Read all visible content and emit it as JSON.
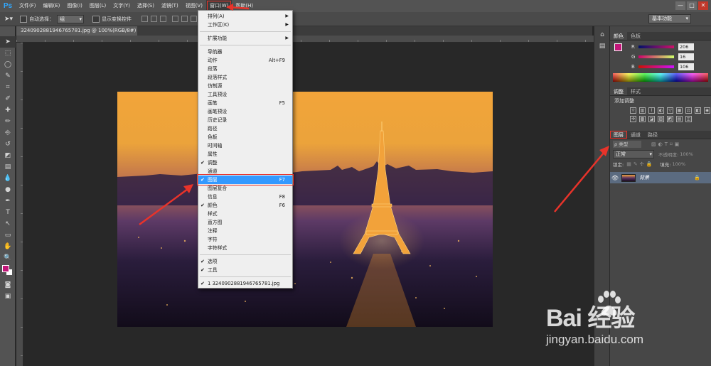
{
  "app": {
    "logo": "Ps"
  },
  "menubar": {
    "items": [
      "文件(F)",
      "编辑(E)",
      "图像(I)",
      "图层(L)",
      "文字(Y)",
      "选择(S)",
      "滤镜(T)",
      "视图(V)",
      "窗口(W)",
      "帮助(H)"
    ],
    "active_index": 8
  },
  "window_controls": {
    "minimize": "—",
    "maximize": "□",
    "close": "✕"
  },
  "options_bar": {
    "auto_select_label": "自动选择：",
    "auto_select_value": "组",
    "show_transform_label": "显示变换控件",
    "workspace": "基本功能"
  },
  "document": {
    "tab_title": "3240902881946765781.jpg @ 100%(RGB/8#)"
  },
  "toolbar": {
    "tools": [
      "move-icon",
      "marquee-icon",
      "lasso-icon",
      "quick-select-icon",
      "crop-icon",
      "eyedropper-icon",
      "healing-icon",
      "brush-icon",
      "clone-stamp-icon",
      "history-brush-icon",
      "eraser-icon",
      "gradient-icon",
      "blur-icon",
      "dodge-icon",
      "pen-icon",
      "type-icon",
      "path-select-icon",
      "rectangle-icon",
      "hand-icon",
      "zoom-icon"
    ],
    "glyphs": [
      "➤",
      "⬚",
      "◯",
      "✎",
      "⌗",
      "✐",
      "✚",
      "✏",
      "⎆",
      "↺",
      "◩",
      "▤",
      "💧",
      "●",
      "✒",
      "T",
      "↖",
      "▭",
      "✋",
      "🔍"
    ],
    "foreground_color": "#c2177a",
    "background_color": "#ffffff"
  },
  "window_menu": {
    "items": [
      {
        "label": "排列(A)",
        "submenu": true
      },
      {
        "label": "工作区(K)",
        "submenu": true
      },
      {
        "sep": true
      },
      {
        "label": "扩展功能",
        "submenu": true
      },
      {
        "sep": true
      },
      {
        "label": "导航器"
      },
      {
        "label": "动作",
        "shortcut": "Alt+F9"
      },
      {
        "label": "段落"
      },
      {
        "label": "段落样式"
      },
      {
        "label": "仿制源"
      },
      {
        "label": "工具预设"
      },
      {
        "label": "画笔",
        "shortcut": "F5"
      },
      {
        "label": "画笔预设"
      },
      {
        "label": "历史记录"
      },
      {
        "label": "路径"
      },
      {
        "label": "色板"
      },
      {
        "label": "时间轴"
      },
      {
        "label": "属性"
      },
      {
        "label": "调整",
        "checked": true
      },
      {
        "label": "通道"
      },
      {
        "label": "图层",
        "shortcut": "F7",
        "checked": true,
        "highlighted": true
      },
      {
        "label": "图层复合"
      },
      {
        "label": "信息",
        "shortcut": "F8"
      },
      {
        "label": "颜色",
        "shortcut": "F6",
        "checked": true
      },
      {
        "label": "样式"
      },
      {
        "label": "直方图"
      },
      {
        "label": "注释"
      },
      {
        "label": "字符"
      },
      {
        "label": "字符样式"
      },
      {
        "sep": true
      },
      {
        "label": "选项",
        "checked": true
      },
      {
        "label": "工具",
        "checked": true
      },
      {
        "sep": true
      },
      {
        "label": "1 3240902881946765781.jpg",
        "checked": true
      }
    ]
  },
  "color_panel": {
    "tabs": [
      "颜色",
      "色板"
    ],
    "channels": [
      {
        "label": "R",
        "value": "206"
      },
      {
        "label": "G",
        "value": "16"
      },
      {
        "label": "B",
        "value": "106"
      }
    ]
  },
  "adjust_panel": {
    "tabs": [
      "调整",
      "样式"
    ],
    "add_label": "添加调整",
    "icons": [
      "brightness-icon",
      "levels-icon",
      "curves-icon",
      "exposure-icon",
      "vibrance-icon",
      "hue-icon",
      "color-balance-icon",
      "bw-icon",
      "photo-filter-icon",
      "channel-mixer-icon",
      "color-lookup-icon",
      "invert-icon",
      "posterize-icon",
      "threshold-icon",
      "gradient-map-icon",
      "selective-color-icon"
    ],
    "glyphs": [
      "☼",
      "▥",
      "⌇",
      "◐",
      "▽",
      "▦",
      "⚖",
      "◧",
      "◉",
      "✣",
      "▩",
      "◪",
      "▨",
      "◩",
      "▤",
      "◫"
    ]
  },
  "layers_panel": {
    "tabs": [
      "图层",
      "通道",
      "路径"
    ],
    "filter_label": "ρ 类型",
    "blend_mode": "正常",
    "opacity_label": "不透明度:",
    "opacity_value": "100%",
    "lock_label": "锁定:",
    "fill_label": "填充:",
    "fill_value": "100%",
    "layer_name": "背景"
  },
  "watermark": {
    "brand": "Bai 经验",
    "url": "jingyan.baidu.com"
  }
}
